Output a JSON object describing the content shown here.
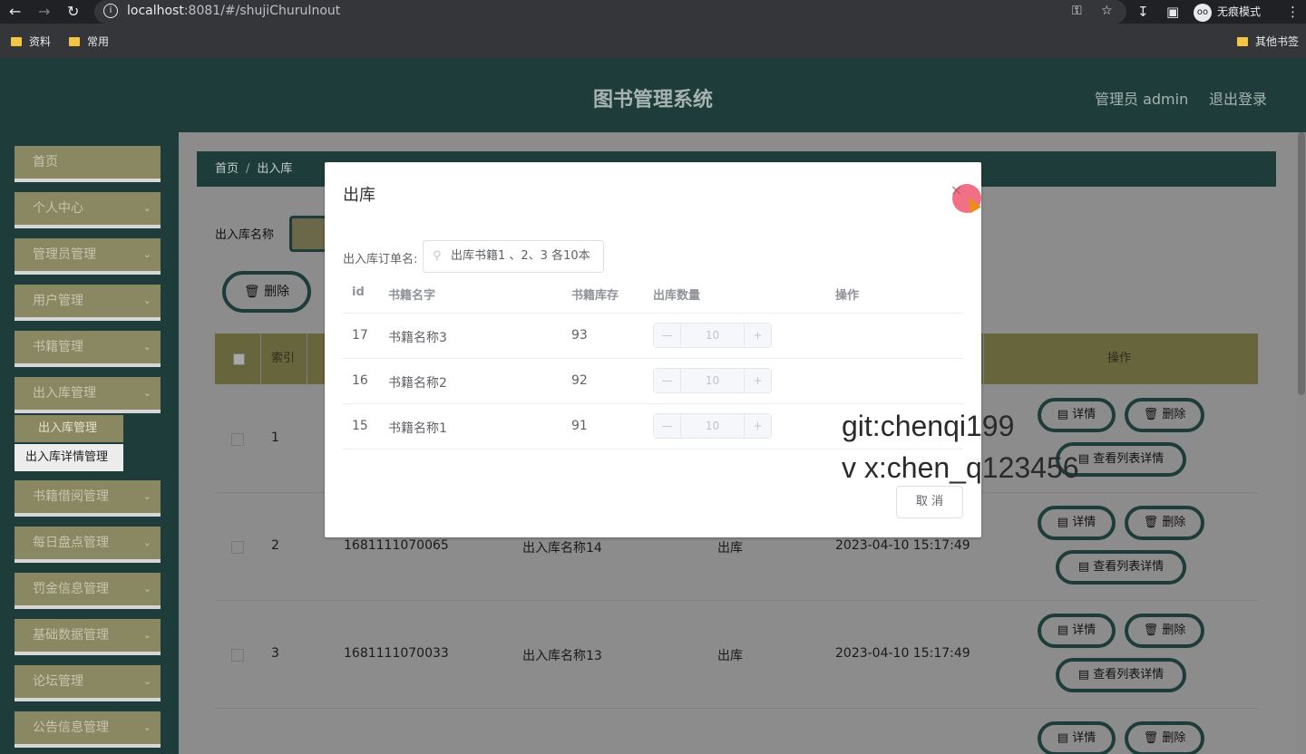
{
  "browser": {
    "url_host": "localhost",
    "url_rest": ":8081/#/shujiChuruInout",
    "incognito_label": "无痕模式",
    "bookmarks": [
      "资料",
      "常用"
    ],
    "other_bookmarks": "其他书签"
  },
  "header": {
    "title": "图书管理系统",
    "admin_label": "管理员 admin",
    "logout_label": "退出登录"
  },
  "sidebar": {
    "items": [
      {
        "label": "首页",
        "has_chevron": false
      },
      {
        "label": "个人中心",
        "has_chevron": true
      },
      {
        "label": "管理员管理",
        "has_chevron": true
      },
      {
        "label": "用户管理",
        "has_chevron": true
      },
      {
        "label": "书籍管理",
        "has_chevron": true
      },
      {
        "label": "出入库管理",
        "has_chevron": true
      },
      {
        "label": "书籍借阅管理",
        "has_chevron": true
      },
      {
        "label": "每日盘点管理",
        "has_chevron": true
      },
      {
        "label": "罚金信息管理",
        "has_chevron": true
      },
      {
        "label": "基础数据管理",
        "has_chevron": true
      },
      {
        "label": "论坛管理",
        "has_chevron": true
      },
      {
        "label": "公告信息管理",
        "has_chevron": true
      }
    ],
    "sub_items": [
      "出入库管理",
      "出入库详情管理"
    ]
  },
  "main": {
    "breadcrumb": [
      "首页",
      "出入库"
    ],
    "search_label": "出入库名称",
    "delete_button": "删除",
    "table": {
      "headers": {
        "index": "索引",
        "actions": "操作"
      },
      "rows": [
        {
          "index": "1",
          "order_no": "",
          "name": "",
          "type": "",
          "time": ""
        },
        {
          "index": "2",
          "order_no": "1681111070065",
          "name": "出入库名称14",
          "type": "出库",
          "time": "2023-04-10 15:17:49"
        },
        {
          "index": "3",
          "order_no": "1681111070033",
          "name": "出入库名称13",
          "type": "出库",
          "time": "2023-04-10 15:17:49"
        }
      ],
      "row_actions": {
        "detail": "详情",
        "delete": "删除",
        "list_detail": "查看列表详情"
      }
    }
  },
  "modal": {
    "title": "出库",
    "order_label": "出入库订单名:",
    "order_value": "出库书籍1 、2、3 各10本",
    "columns": {
      "id": "id",
      "name": "书籍名字",
      "stock": "书籍库存",
      "qty": "出库数量",
      "ops": "操作"
    },
    "rows": [
      {
        "id": "17",
        "name": "书籍名称3",
        "stock": "93",
        "qty": "10"
      },
      {
        "id": "16",
        "name": "书籍名称2",
        "stock": "92",
        "qty": "10"
      },
      {
        "id": "15",
        "name": "书籍名称1",
        "stock": "91",
        "qty": "10"
      }
    ],
    "cancel_label": "取 消"
  },
  "watermark": [
    "git:chenqi199",
    "v x:chen_q123456"
  ],
  "colors": {
    "header_bg": "#1e3d3a",
    "menu_bg": "#8a8763",
    "table_head": "#66653c",
    "overlay_gray": "#8c8c8c"
  }
}
